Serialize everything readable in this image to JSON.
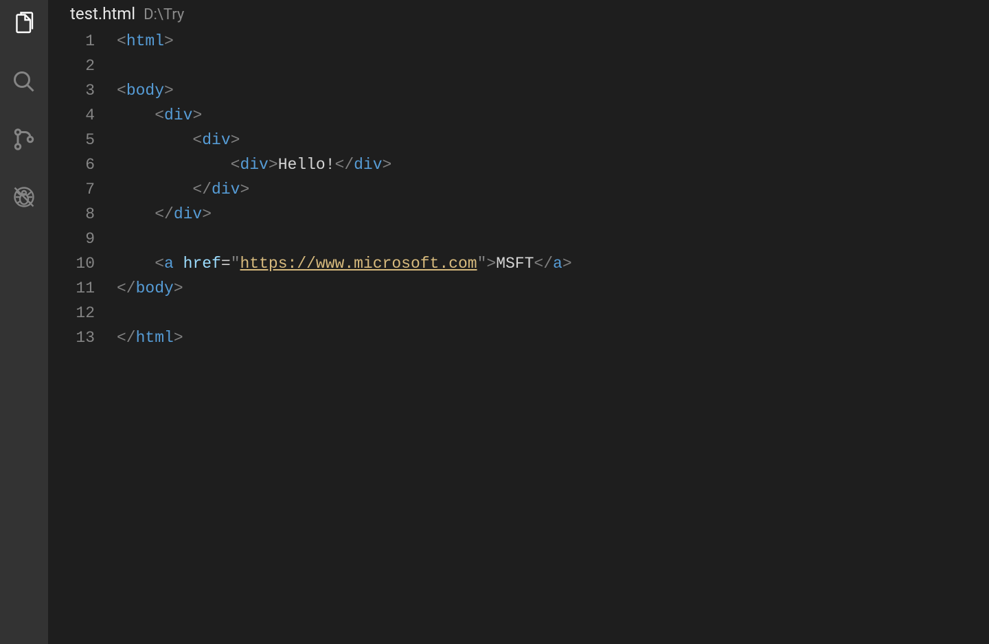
{
  "activityBar": {
    "items": [
      {
        "name": "explorer-icon",
        "active": true
      },
      {
        "name": "search-icon",
        "active": false
      },
      {
        "name": "source-control-icon",
        "active": false
      },
      {
        "name": "debug-icon",
        "active": false
      }
    ]
  },
  "editor": {
    "filename": "test.html",
    "filepath": "D:\\Try",
    "lineNumbers": [
      "1",
      "2",
      "3",
      "4",
      "5",
      "6",
      "7",
      "8",
      "9",
      "10",
      "11",
      "12",
      "13"
    ],
    "lines": [
      [
        {
          "t": "br",
          "v": "<"
        },
        {
          "t": "tag",
          "v": "html"
        },
        {
          "t": "br",
          "v": ">"
        }
      ],
      [],
      [
        {
          "t": "br",
          "v": "<"
        },
        {
          "t": "tag",
          "v": "body"
        },
        {
          "t": "br",
          "v": ">"
        }
      ],
      [
        {
          "t": "txt",
          "v": "    "
        },
        {
          "t": "br",
          "v": "<"
        },
        {
          "t": "tag",
          "v": "div"
        },
        {
          "t": "br",
          "v": ">"
        }
      ],
      [
        {
          "t": "txt",
          "v": "        "
        },
        {
          "t": "br",
          "v": "<"
        },
        {
          "t": "tag",
          "v": "div"
        },
        {
          "t": "br",
          "v": ">"
        }
      ],
      [
        {
          "t": "txt",
          "v": "            "
        },
        {
          "t": "br",
          "v": "<"
        },
        {
          "t": "tag",
          "v": "div"
        },
        {
          "t": "br",
          "v": ">"
        },
        {
          "t": "txt",
          "v": "Hello!"
        },
        {
          "t": "br",
          "v": "</"
        },
        {
          "t": "tag",
          "v": "div"
        },
        {
          "t": "br",
          "v": ">"
        }
      ],
      [
        {
          "t": "txt",
          "v": "        "
        },
        {
          "t": "br",
          "v": "</"
        },
        {
          "t": "tag",
          "v": "div"
        },
        {
          "t": "br",
          "v": ">"
        }
      ],
      [
        {
          "t": "txt",
          "v": "    "
        },
        {
          "t": "br",
          "v": "</"
        },
        {
          "t": "tag",
          "v": "div"
        },
        {
          "t": "br",
          "v": ">"
        }
      ],
      [],
      [
        {
          "t": "txt",
          "v": "    "
        },
        {
          "t": "br",
          "v": "<"
        },
        {
          "t": "tag",
          "v": "a"
        },
        {
          "t": "txt",
          "v": " "
        },
        {
          "t": "attr",
          "v": "href"
        },
        {
          "t": "op",
          "v": "="
        },
        {
          "t": "quote",
          "v": "\""
        },
        {
          "t": "str",
          "v": "https://www.microsoft.com"
        },
        {
          "t": "quote",
          "v": "\""
        },
        {
          "t": "br",
          "v": ">"
        },
        {
          "t": "txt",
          "v": "MSFT"
        },
        {
          "t": "br",
          "v": "</"
        },
        {
          "t": "tag",
          "v": "a"
        },
        {
          "t": "br",
          "v": ">"
        }
      ],
      [
        {
          "t": "br",
          "v": "</"
        },
        {
          "t": "tag",
          "v": "body"
        },
        {
          "t": "br",
          "v": ">"
        }
      ],
      [],
      [
        {
          "t": "br",
          "v": "</"
        },
        {
          "t": "tag",
          "v": "html"
        },
        {
          "t": "br",
          "v": ">"
        }
      ]
    ]
  }
}
